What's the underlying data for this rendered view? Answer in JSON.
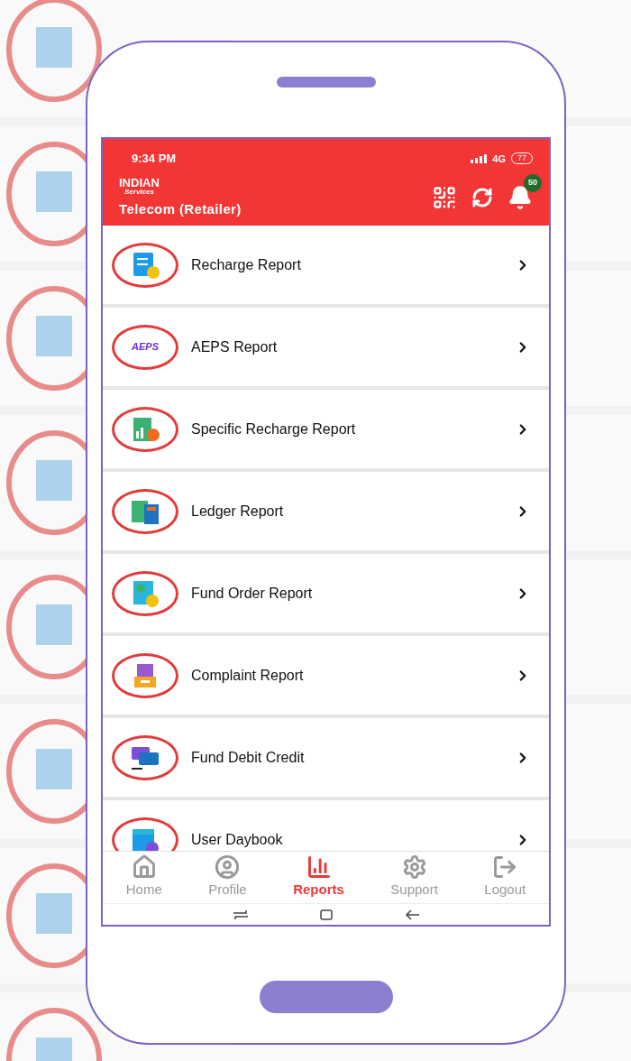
{
  "status_bar": {
    "time": "9:34 PM",
    "network": "4G",
    "battery": "77"
  },
  "app_bar": {
    "logo_top": "INDIAN",
    "logo_bottom": "Services",
    "title": "Telecom (Retailer)",
    "notification_count": "50"
  },
  "reports": [
    {
      "label": "Recharge Report"
    },
    {
      "label": "AEPS Report",
      "logo_text": "AEPS"
    },
    {
      "label": "Specific Recharge Report"
    },
    {
      "label": "Ledger Report"
    },
    {
      "label": "Fund Order Report"
    },
    {
      "label": "Complaint Report"
    },
    {
      "label": "Fund Debit Credit"
    },
    {
      "label": "User Daybook"
    }
  ],
  "bottom_nav": [
    {
      "label": "Home",
      "selected": false
    },
    {
      "label": "Profile",
      "selected": false
    },
    {
      "label": "Reports",
      "selected": true
    },
    {
      "label": "Support",
      "selected": false
    },
    {
      "label": "Logout",
      "selected": false
    }
  ]
}
